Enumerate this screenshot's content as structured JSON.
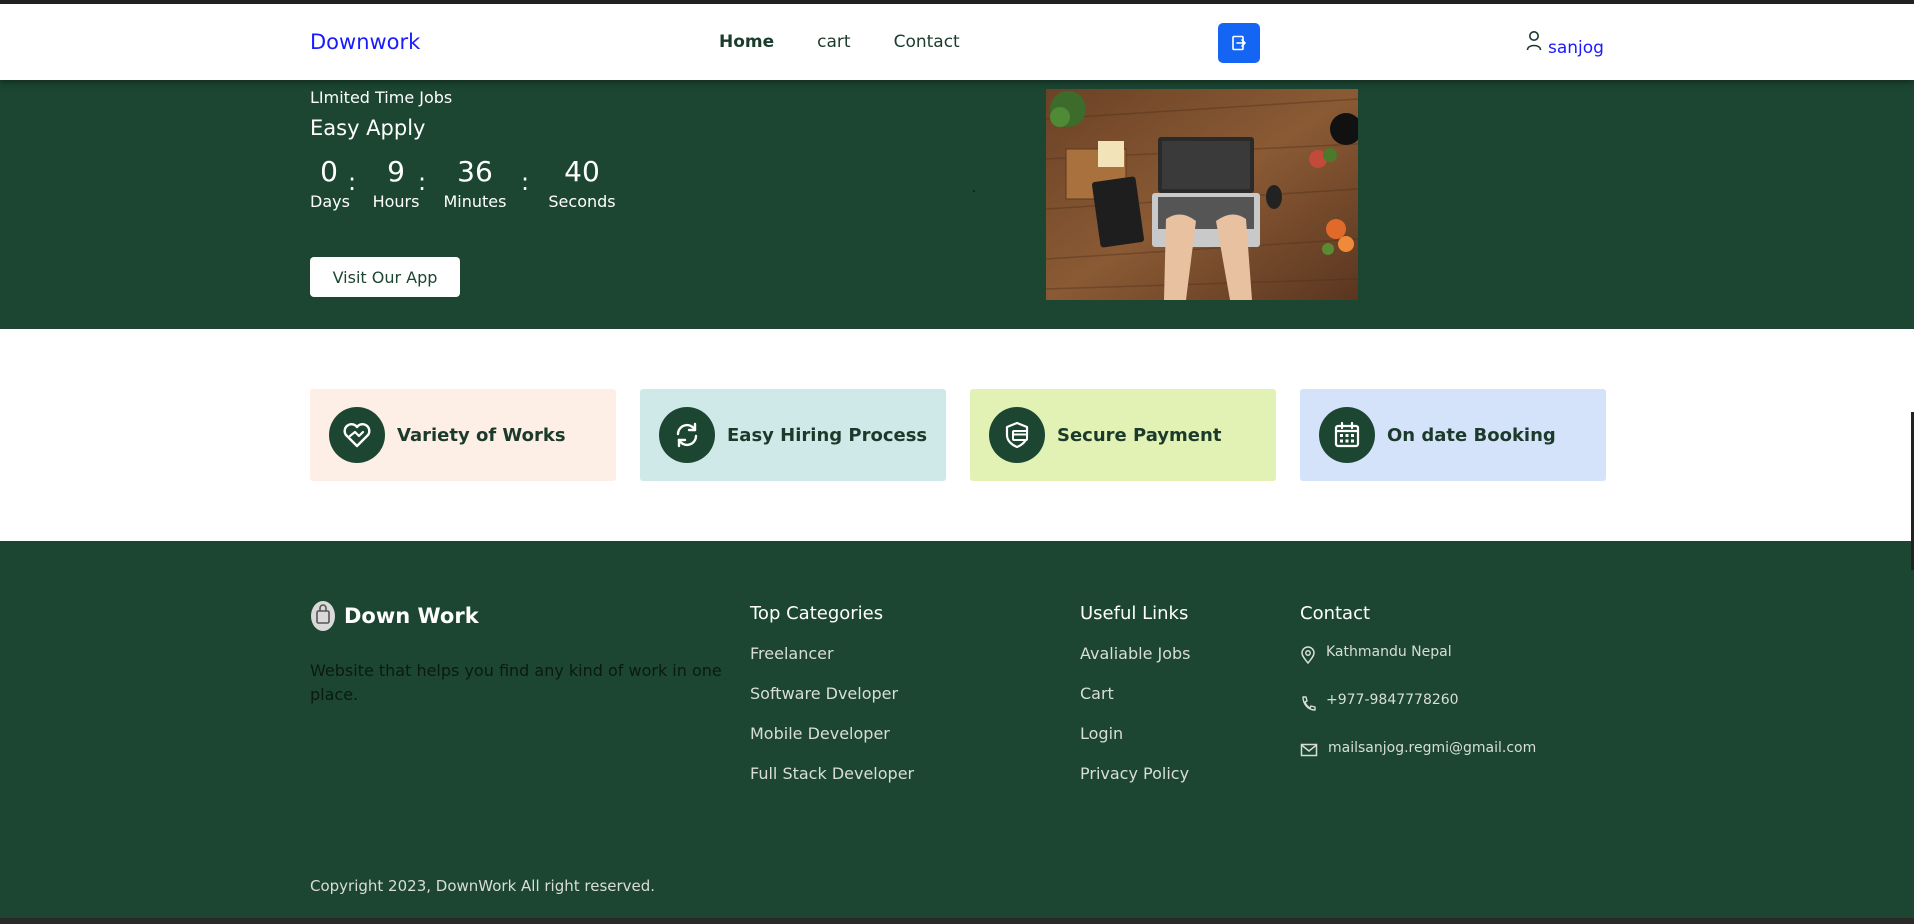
{
  "header": {
    "brand": "Downwork",
    "nav": [
      {
        "label": "Home"
      },
      {
        "label": "cart"
      },
      {
        "label": "Contact"
      }
    ],
    "user_name": "sanjog",
    "logout_icon": "logout-icon",
    "user_icon": "user-icon"
  },
  "hero": {
    "subtitle": "LImited Time Jobs",
    "title": "Easy Apply",
    "countdown": {
      "days": "0",
      "days_label": "Days",
      "hours": "9",
      "hours_label": "Hours",
      "minutes": "36",
      "minutes_label": "Minutes",
      "seconds": "40",
      "seconds_label": "Seconds",
      "separator": ":"
    },
    "button_label": "Visit Our App"
  },
  "features": [
    {
      "label": "Variety of Works",
      "icon": "heart-hand-icon",
      "color": "#fdeee6"
    },
    {
      "label": "Easy Hiring Process",
      "icon": "refresh-icon",
      "color": "#cfe9e8"
    },
    {
      "label": "Secure Payment",
      "icon": "secure-card-icon",
      "color": "#e1f2b4"
    },
    {
      "label": "On date Booking",
      "icon": "calendar-icon",
      "color": "#d4e3fa"
    }
  ],
  "footer": {
    "brand": "Down Work",
    "description": "Website that helps you find any kind of work in one place.",
    "categories": {
      "title": "Top Categories",
      "items": [
        "Freelancer",
        "Software Dveloper",
        "Mobile Developer",
        "Full Stack Developer"
      ]
    },
    "useful": {
      "title": "Useful Links",
      "items": [
        "Avaliable Jobs",
        "Cart",
        "Login",
        "Privacy Policy"
      ]
    },
    "contact": {
      "title": "Contact",
      "address": "Kathmandu Nepal",
      "phone": "+977-9847778260",
      "email": "mailsanjog.regmi@gmail.com"
    },
    "copyright": "Copyright 2023, DownWork All right reserved."
  },
  "colors": {
    "primary_green": "#1c4632",
    "brand_blue": "#1a1aff",
    "button_blue": "#1565f5"
  }
}
